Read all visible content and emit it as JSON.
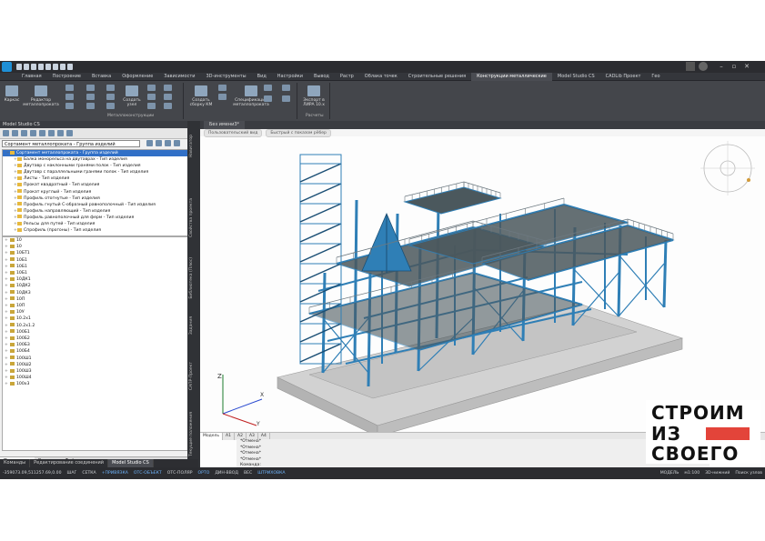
{
  "window": {
    "ribbon_tabs": [
      "Главная",
      "Построение",
      "Вставка",
      "Оформление",
      "Зависимости",
      "3D-инструменты",
      "Вид",
      "Настройки",
      "Вывод",
      "Растр",
      "Облака точек",
      "Строительные решения",
      "Конструкции металлические",
      "Model Studio CS",
      "CADLib Проект",
      "Гео"
    ],
    "active_tab": "Конструкции металлические"
  },
  "ribbon": {
    "buttons": {
      "karkas": "Каркас",
      "editor": "Редактор металлопроката",
      "create_node": "Создать узел",
      "create_assembly": "Создать сборку КМ",
      "spec": "Спецификация металлопроката",
      "export": "Экспорт в ЛИРА 10.x"
    },
    "groups": {
      "metal": "Металлоконструкции",
      "calc": "Расчеты"
    }
  },
  "left_panel": {
    "title": "Model Studio CS",
    "combo": "Сортамент металлопроката - Группа изделий",
    "tree": [
      {
        "label": "Сортамент металлопроката - Группа изделий",
        "selected": true,
        "root": true
      },
      {
        "label": "Балка монорельса на двутаврах - Тип изделия"
      },
      {
        "label": "Двутавр с наклонными гранями полок - Тип изделия"
      },
      {
        "label": "Двутавр с параллельными гранями полок - Тип изделия"
      },
      {
        "label": "Листы - Тип изделия"
      },
      {
        "label": "Прокат квадратный - Тип изделия"
      },
      {
        "label": "Прокат круглый - Тип изделия"
      },
      {
        "label": "Профиль отогнутые - Тип изделия"
      },
      {
        "label": "Профиль гнутый С-образный равнополочный - Тип изделия"
      },
      {
        "label": "Профиль направляющий - Тип изделия"
      },
      {
        "label": "Профиль равнополочный для ферм - Тип изделия"
      },
      {
        "label": "Рельсы для путей - Тип изделия"
      },
      {
        "label": "Спрофиль (прогоны) - Тип изделия"
      }
    ],
    "list": [
      "10",
      "10",
      "10БТ1",
      "10Б1",
      "10Б1",
      "10Б1",
      "10ДК1",
      "10ДК2",
      "10ДК3",
      "10П",
      "10П",
      "10У",
      "10.2х1",
      "10.2х1.2",
      "100Б1",
      "100Б2",
      "100Б3",
      "100Б4",
      "100Ш1",
      "100Ш2",
      "100Ш3",
      "100Ш4",
      "100х3"
    ],
    "bottom_tabs": [
      "Параметры",
      "Рисунок",
      "Файлы"
    ],
    "active_bottom_tab": "Параметры"
  },
  "side_tabs": [
    "Навигатор",
    "Свойства проекта",
    "Библиотека (Плюс)",
    "Задания",
    "САПР-Проект",
    "Текущие положения"
  ],
  "command_tabs": [
    "Команды",
    "Редактирование соединений",
    "Model Studio CS"
  ],
  "active_command_tab": "Model Studio CS",
  "viewport": {
    "doc_tab": "Без имени3*",
    "crumbs": [
      "Пользовательский вид",
      "Быстрый с показом рёбер"
    ],
    "model_tabs": [
      "Модель",
      "А1",
      "А2",
      "А3",
      "А4"
    ],
    "active_model_tab": "Модель",
    "cmd_lines": [
      "*Отмена*",
      "*Отмена*",
      "*Отмена*",
      "*Отмена*",
      "Команда:"
    ],
    "axis_labels": {
      "x": "X",
      "y": "Y",
      "z": "Z"
    }
  },
  "statusbar": {
    "coords": "-359073.09,511257.69,0.00",
    "items": [
      {
        "label": "ШАГ",
        "on": false
      },
      {
        "label": "СЕТКА",
        "on": false
      },
      {
        "label": "+ПРИВЯЗКА",
        "on": true
      },
      {
        "label": "ОТС-ОБЪЕКТ",
        "on": true
      },
      {
        "label": "ОТС-ПОЛЯР",
        "on": false
      },
      {
        "label": "ОРТО",
        "on": true
      },
      {
        "label": "ДИН-ВВОД",
        "on": false
      },
      {
        "label": "ВЕС",
        "on": false
      },
      {
        "label": "ШТРИХОВКА",
        "on": true
      }
    ],
    "model_label": "МОДЕЛЬ",
    "scale": "м1:100",
    "mode": "3D-нижний",
    "search": "Поиск узлов"
  },
  "overlay_logo": {
    "line1": "СТРОИМ",
    "line2": "ИЗ",
    "line3": "СВОЕГО"
  },
  "colors": {
    "steel": "#2f7fb6",
    "grate": "#4d5a5f",
    "foundation": "#cfcfcf",
    "accent_red": "#e3443a"
  }
}
